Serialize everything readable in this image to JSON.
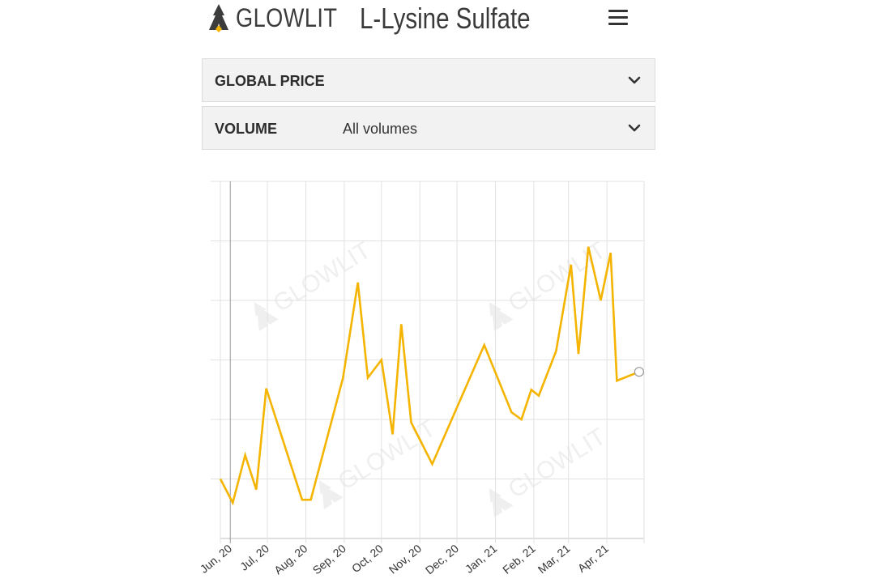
{
  "brand": {
    "name": "GLOWLIT"
  },
  "page": {
    "title": "L-Lysine Sulfate"
  },
  "filters": [
    {
      "label": "GLOBAL PRICE",
      "value": ""
    },
    {
      "label": "VOLUME",
      "value": "All volumes"
    }
  ],
  "colors": {
    "line": "#f4b400",
    "accent": "#f4b400",
    "grid": "#e2e2e2"
  },
  "icons": {
    "menu": "hamburger-menu-icon",
    "expand": "chevron-down-icon"
  },
  "chart_data": {
    "type": "line",
    "title": "",
    "xlabel": "",
    "ylabel": "",
    "x_tick_labels": [
      "Jun, 20",
      "Jul, 20",
      "Aug, 20",
      "Sep, 20",
      "Oct, 20",
      "Nov, 20",
      "Dec, 20",
      "Jan, 21",
      "Feb, 21",
      "Mar, 21",
      "Apr, 21"
    ],
    "grid": true,
    "y_ticks_shown": false,
    "ylim": [
      0,
      6
    ],
    "series": [
      {
        "values": [
          {
            "x": "2020-05-24",
            "y": 1.0
          },
          {
            "x": "2020-06-03",
            "y": 0.6
          },
          {
            "x": "2020-06-13",
            "y": 1.4
          },
          {
            "x": "2020-06-22",
            "y": 0.82
          },
          {
            "x": "2020-06-30",
            "y": 2.52
          },
          {
            "x": "2020-07-29",
            "y": 0.65
          },
          {
            "x": "2020-08-05",
            "y": 0.65
          },
          {
            "x": "2020-08-31",
            "y": 2.7
          },
          {
            "x": "2020-09-12",
            "y": 4.3
          },
          {
            "x": "2020-09-20",
            "y": 2.7
          },
          {
            "x": "2020-10-01",
            "y": 3.0
          },
          {
            "x": "2020-10-10",
            "y": 1.75
          },
          {
            "x": "2020-10-17",
            "y": 3.6
          },
          {
            "x": "2020-10-25",
            "y": 1.95
          },
          {
            "x": "2020-11-11",
            "y": 1.25
          },
          {
            "x": "2020-12-23",
            "y": 3.25
          },
          {
            "x": "2021-01-14",
            "y": 2.12
          },
          {
            "x": "2021-01-22",
            "y": 2.0
          },
          {
            "x": "2021-01-30",
            "y": 2.5
          },
          {
            "x": "2021-02-05",
            "y": 2.4
          },
          {
            "x": "2021-02-19",
            "y": 3.15
          },
          {
            "x": "2021-03-03",
            "y": 4.6
          },
          {
            "x": "2021-03-09",
            "y": 3.1
          },
          {
            "x": "2021-03-17",
            "y": 4.9
          },
          {
            "x": "2021-03-27",
            "y": 4.0
          },
          {
            "x": "2021-04-04",
            "y": 4.8
          },
          {
            "x": "2021-04-09",
            "y": 2.65
          },
          {
            "x": "2021-04-27",
            "y": 2.8
          }
        ]
      }
    ]
  }
}
